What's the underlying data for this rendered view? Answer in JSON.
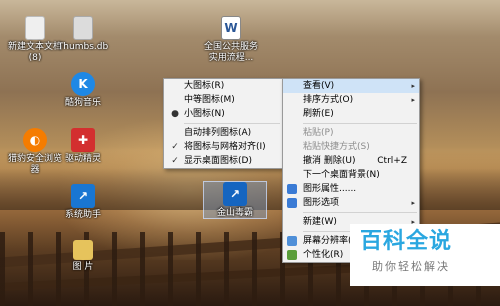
{
  "desktop": {
    "icons": [
      {
        "label": "新建文本文档(8)",
        "icon": "text-document-icon",
        "color": "#eeeeee"
      },
      {
        "label": "Thumbs.db",
        "icon": "file-icon",
        "color": "#d9d9d9"
      },
      {
        "label": "全国公共服务实用流程...",
        "icon": "word-document-icon",
        "color": "#2b5797"
      },
      {
        "label": "酷狗音乐",
        "icon": "kugou-icon",
        "color": "#1e88e5"
      },
      {
        "label": "猎豹安全浏览器",
        "icon": "liebao-browser-icon",
        "color": "#f57c00"
      },
      {
        "label": "驱动精灵",
        "icon": "driver-genius-icon",
        "color": "#d32f2f"
      },
      {
        "label": "系统助手",
        "icon": "system-helper-icon",
        "color": "#1976d2"
      },
      {
        "label": "金山毒霸",
        "icon": "kingsoft-antivirus-icon",
        "color": "#1565c0"
      },
      {
        "label": "图        片",
        "icon": "folder-icon",
        "color": "#e6c35c"
      }
    ]
  },
  "view_submenu": {
    "items": [
      {
        "label": "大图标(R)"
      },
      {
        "label": "中等图标(M)"
      },
      {
        "label": "小图标(N)",
        "mark": "●"
      },
      {
        "label": "自动排列图标(A)"
      },
      {
        "label": "将图标与网格对齐(I)",
        "mark": "✓"
      },
      {
        "label": "显示桌面图标(D)",
        "mark": "✓"
      }
    ]
  },
  "context_menu": {
    "items": [
      {
        "label": "查看(V)",
        "arrow": "▸"
      },
      {
        "label": "排序方式(O)",
        "arrow": "▸"
      },
      {
        "label": "刷新(E)"
      },
      {
        "label": "粘贴(P)"
      },
      {
        "label": "粘贴快捷方式(S)"
      },
      {
        "label": "撤消 删除(U)",
        "shortcut": "Ctrl+Z"
      },
      {
        "label": "下一个桌面背景(N)"
      },
      {
        "label": "图形属性......",
        "icon": "graphics-properties-icon"
      },
      {
        "label": "图形选项",
        "icon": "graphics-options-icon",
        "arrow": "▸"
      },
      {
        "label": "新建(W)",
        "arrow": "▸"
      },
      {
        "label": "屏幕分辨率(C)",
        "icon": "screen-resolution-icon"
      },
      {
        "label": "个性化(R)",
        "icon": "personalize-icon"
      }
    ]
  },
  "watermark": {
    "title": "百科全说",
    "subtitle": "助你轻松解决"
  }
}
